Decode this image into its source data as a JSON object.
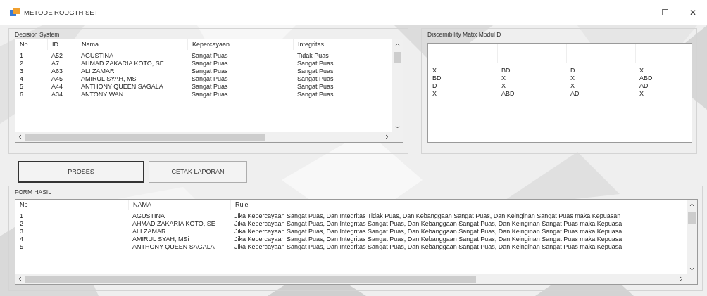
{
  "window": {
    "title": "METODE ROUGTH SET",
    "controls": [
      "—",
      "☐",
      "✕"
    ]
  },
  "decision_system": {
    "title": "Decision System",
    "columns": [
      "No",
      "ID",
      "Nama",
      "Kepercayaan",
      "Integritas"
    ],
    "rows": [
      [
        "1",
        "A52",
        "AGUSTINA",
        "Sangat Puas",
        "Tidak Puas"
      ],
      [
        "2",
        "A7",
        "AHMAD ZAKARIA KOTO, SE",
        "Sangat Puas",
        "Sangat Puas"
      ],
      [
        "3",
        "A63",
        "ALI ZAMAR",
        "Sangat Puas",
        "Sangat Puas"
      ],
      [
        "4",
        "A45",
        "AMIRUL SYAH, MSi",
        "Sangat Puas",
        "Sangat Puas"
      ],
      [
        "5",
        "A44",
        "ANTHONY QUEEN SAGALA",
        "Sangat Puas",
        "Sangat Puas"
      ],
      [
        "6",
        "A34",
        "ANTONY WAN",
        "Sangat Puas",
        "Sangat Puas"
      ]
    ]
  },
  "discernibility": {
    "title": "Discernibility Matix Modul D",
    "rows": [
      [
        "X",
        "BD",
        "D",
        "X"
      ],
      [
        "BD",
        "X",
        "X",
        "ABD"
      ],
      [
        "D",
        "X",
        "X",
        "AD"
      ],
      [
        "X",
        "ABD",
        "AD",
        "X"
      ]
    ]
  },
  "buttons": [
    {
      "label": "PROSES",
      "focused": true
    },
    {
      "label": "CETAK LAPORAN",
      "focused": false
    }
  ],
  "form_hasil": {
    "title": "FORM HASIL",
    "columns": [
      "No",
      "NAMA",
      "Rule"
    ],
    "rows": [
      [
        "1",
        "AGUSTINA",
        "Jika Kepercayaan Sangat Puas, Dan Integritas Tidak Puas, Dan Kebanggaan Sangat Puas, Dan Keinginan Sangat Puas maka Kepuasan"
      ],
      [
        "2",
        "AHMAD ZAKARIA KOTO, SE",
        "Jika Kepercayaan Sangat Puas, Dan Integritas Sangat Puas, Dan Kebanggaan Sangat Puas, Dan Keinginan Sangat Puas maka Kepuasa"
      ],
      [
        "3",
        "ALI ZAMAR",
        "Jika Kepercayaan Sangat Puas, Dan Integritas Sangat Puas, Dan Kebanggaan Sangat Puas, Dan Keinginan Sangat Puas maka Kepuasa"
      ],
      [
        "4",
        "AMIRUL SYAH, MSi",
        "Jika Kepercayaan Sangat Puas, Dan Integritas Sangat Puas, Dan Kebanggaan Sangat Puas, Dan Keinginan Sangat Puas maka Kepuasa"
      ],
      [
        "5",
        "ANTHONY QUEEN SAGALA",
        "Jika Kepercayaan Sangat Puas, Dan Integritas Sangat Puas, Dan Kebanggaan Sangat Puas, Dan Keinginan Sangat Puas maka Kepuasa"
      ]
    ]
  }
}
